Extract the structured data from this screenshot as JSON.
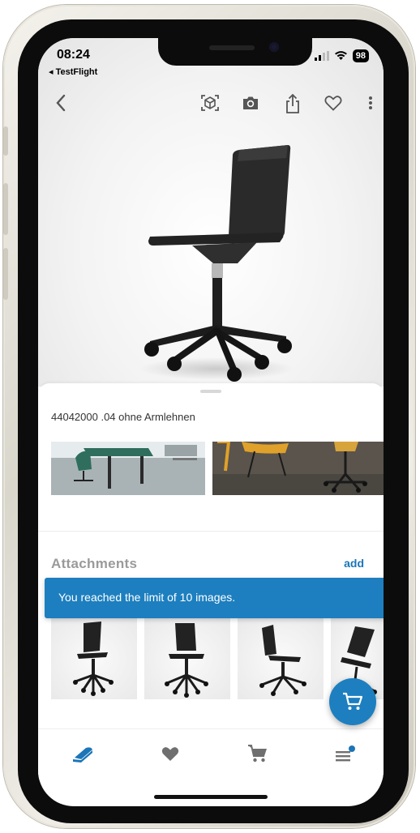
{
  "status_bar": {
    "time": "08:24",
    "back_app": "◂ TestFlight",
    "battery": "98"
  },
  "product": {
    "id_label": "44042000 .04 ohne Armlehnen"
  },
  "attachments": {
    "title": "Attachments",
    "add_label": "add"
  },
  "toast": {
    "message": "You reached the limit of 10 images."
  },
  "colors": {
    "accent": "#1d7fbf",
    "tab_active": "#1b75b8",
    "tab_inactive": "#6f6f6f"
  },
  "toolbar_icons": [
    "back-chevron-icon",
    "ar-view-icon",
    "camera-icon",
    "share-icon",
    "heart-icon",
    "more-vertical-icon"
  ],
  "tabs": [
    {
      "name": "catalog",
      "icon": "book-icon",
      "active": true
    },
    {
      "name": "favorites",
      "icon": "heart-icon",
      "active": false
    },
    {
      "name": "cart",
      "icon": "cart-icon",
      "active": false
    },
    {
      "name": "menu",
      "icon": "menu-icon",
      "active": false,
      "badge": true
    }
  ]
}
